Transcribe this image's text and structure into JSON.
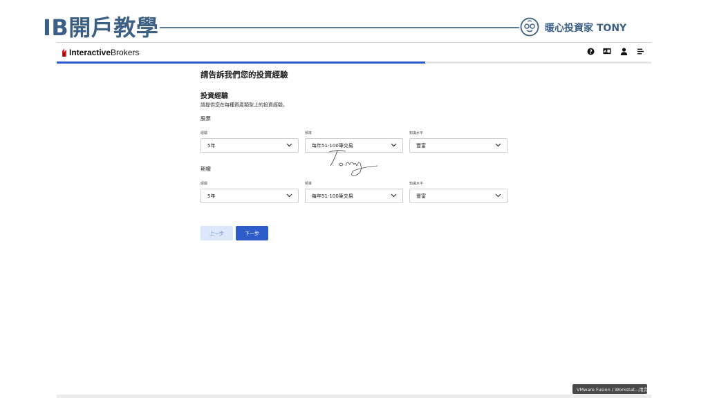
{
  "banner": {
    "title": "IB開戶教學",
    "brand": "暖心投資家 TONY",
    "accent_color": "#3c5f86"
  },
  "header": {
    "logo_bold": "Interactive",
    "logo_rest": "Brokers",
    "icons": [
      "help-icon",
      "language-icon",
      "user-icon",
      "menu-icon"
    ]
  },
  "progress": {
    "fraction": 0.62,
    "color": "#2a59c9"
  },
  "page": {
    "heading": "請告訴我們您的投資經驗",
    "section_title": "投資經驗",
    "section_desc": "請提供您在每種資產類型上的投資經驗。"
  },
  "assets": [
    {
      "name": "股票",
      "fields": [
        {
          "label": "經驗",
          "value": "5年"
        },
        {
          "label": "頻率",
          "value": "每年51-100筆交易"
        },
        {
          "label": "知識水平",
          "value": "豐富"
        }
      ]
    },
    {
      "name": "期權",
      "fields": [
        {
          "label": "經驗",
          "value": "5年"
        },
        {
          "label": "頻率",
          "value": "每年51-100筆交易"
        },
        {
          "label": "知識水平",
          "value": "豐富"
        }
      ]
    }
  ],
  "buttons": {
    "back": "上一步",
    "next": "下一步"
  },
  "tooltip": "VMware Fusion / Workstat...用完全"
}
